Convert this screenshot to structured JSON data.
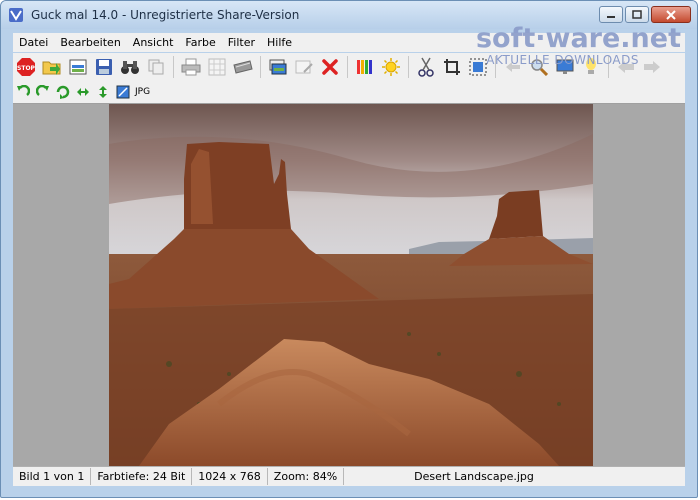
{
  "window": {
    "title": "Guck mal 14.0 - Unregistrierte Share-Version"
  },
  "watermark": {
    "logo": "soft·ware.net",
    "tagline": "AKTUELLE DOWNLOADS"
  },
  "menu": [
    "Datei",
    "Bearbeiten",
    "Ansicht",
    "Farbe",
    "Filter",
    "Hilfe"
  ],
  "toolbar2": {
    "format_label": "JPG"
  },
  "status": {
    "image_index": "Bild 1 von 1",
    "color_depth": "Farbtiefe: 24 Bit",
    "dimensions": "1024 x 768",
    "zoom": "Zoom: 84%",
    "filename": "Desert Landscape.jpg"
  },
  "colors": {
    "accent": "#b9d1ea",
    "canvas": "#a8a8a8"
  }
}
